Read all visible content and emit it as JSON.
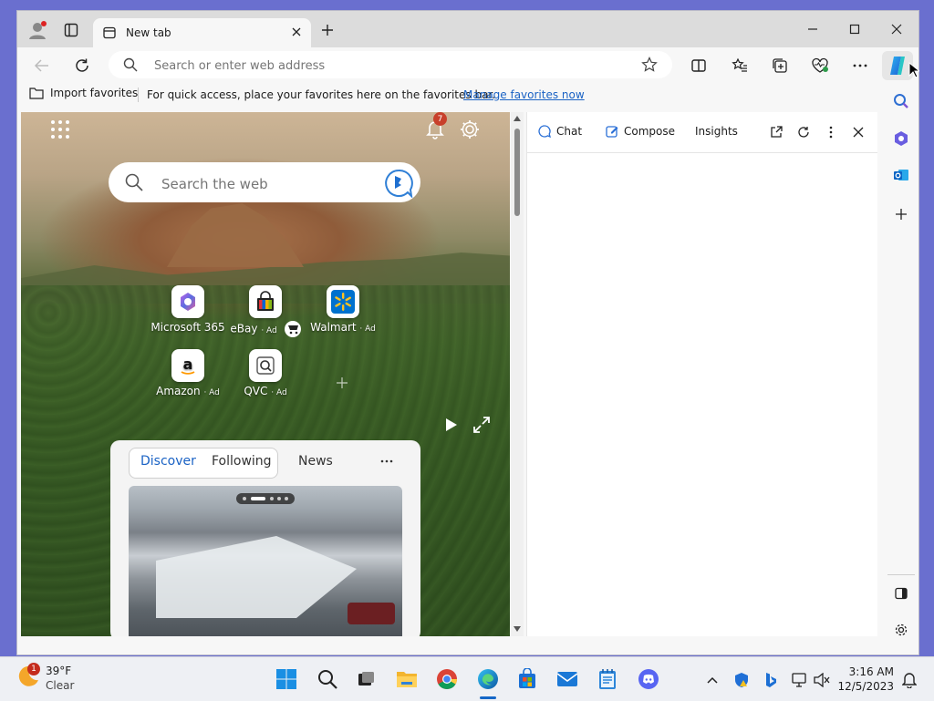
{
  "browser": {
    "tab_title": "New tab",
    "address_placeholder": "Search or enter web address"
  },
  "favorites_bar": {
    "import_label": "Import favorites",
    "message": "For quick access, place your favorites here on the favorites bar.",
    "manage_link": "Manage favorites now"
  },
  "newtab": {
    "search_placeholder": "Search the web",
    "notification_count": "7",
    "quick_links": [
      {
        "label": "Microsoft 365",
        "ad": ""
      },
      {
        "label": "eBay",
        "ad": "· Ad"
      },
      {
        "label": "Walmart",
        "ad": "· Ad"
      },
      {
        "label": "Amazon",
        "ad": "· Ad"
      },
      {
        "label": "QVC",
        "ad": "· Ad"
      }
    ],
    "feed_tabs": [
      "Discover",
      "Following",
      "News"
    ]
  },
  "sidepanel": {
    "tabs": [
      "Chat",
      "Compose",
      "Insights"
    ]
  },
  "taskbar": {
    "weather_temp": "39°F",
    "weather_cond": "Clear",
    "weather_badge": "1",
    "time": "3:16 AM",
    "date": "12/5/2023"
  },
  "colors": {
    "accent": "#1a62c4",
    "badge": "#c8402b",
    "desktop": "#6a6fcf"
  }
}
